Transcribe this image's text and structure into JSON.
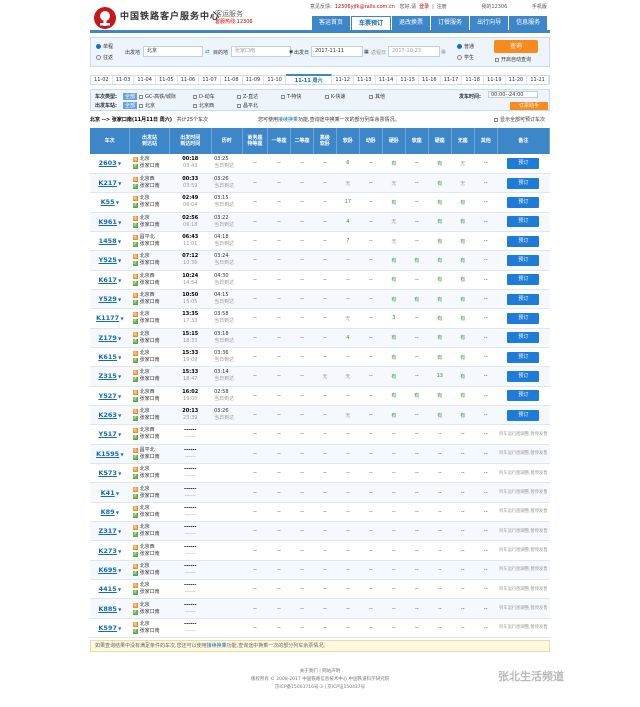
{
  "header": {
    "brand": "中国铁路客户服务中心",
    "sub": "客运服务",
    "hotline": "客服热线:12306",
    "links": [
      "意见反馈:",
      "12306yjfk@rails.com.cn",
      "您好,请",
      "登录",
      "|",
      "注册",
      "我的12306",
      "手机版"
    ],
    "nav": [
      "客运首页",
      "车票预订",
      "退改换票",
      "订餐服务",
      "出行向导",
      "信息服务"
    ]
  },
  "search": {
    "one_way": "单程",
    "round": "往返",
    "from_label": "出发地",
    "from": "北京",
    "to_label": "目的地",
    "to": "张家口南",
    "depart_label": "出发日",
    "depart": "2017-11-11",
    "return_label": "返程日",
    "return": "2017-10-23",
    "normal": "普通",
    "student": "学生",
    "query": "查询",
    "auto": "开启自动查询"
  },
  "dates": [
    "11-02",
    "11-03",
    "11-04",
    "11-05",
    "11-06",
    "11-07",
    "11-08",
    "11-09",
    "11-10",
    "11-11 周六",
    "11-12",
    "11-13",
    "11-14",
    "11-15",
    "11-16",
    "11-17",
    "11-18",
    "11-19",
    "11-20",
    "11-21"
  ],
  "filter": {
    "type_label": "车次类型:",
    "all": "全部",
    "types": [
      "GC-高铁/城际",
      "D-动车",
      "Z-直达",
      "T-特快",
      "K-快速",
      "其他"
    ],
    "station_label": "出发车站:",
    "stations": [
      "北京",
      "北京西",
      "昌平北"
    ],
    "time_label": "发车时间:",
    "time": "00:00--24:00",
    "order": "订票助手"
  },
  "summary": {
    "route": "北京 --> 张家口南(11月11日 周六)",
    "count": "共计25个车次",
    "note1": "您可使用",
    "note_link": "接续换乘",
    "note2": "功能,查询途中换乘一次的部分列车余票情况。",
    "check": "显示全部可预订车次"
  },
  "columns": [
    "车次",
    "出发站\n到达站",
    "出发时间\n到达时间",
    "历时",
    "商务座\n特等座",
    "一等座",
    "二等座",
    "高级\n软卧",
    "软卧",
    "动卧",
    "硬卧",
    "软座",
    "硬座",
    "无座",
    "其他",
    "备注"
  ],
  "book": "预订",
  "na": "列车运行图调整,暂停发售",
  "trains": [
    {
      "no": "2603",
      "s": [
        "北京",
        "张家口南"
      ],
      "ti": [
        "s",
        "e"
      ],
      "t": [
        "00:18",
        "03:43"
      ],
      "d": [
        "03:25",
        "当日到达"
      ],
      "c": [
        "--",
        "--",
        "--",
        "--",
        "6",
        "--",
        "有",
        "--",
        "有",
        "无",
        "--"
      ],
      "ok": true
    },
    {
      "no": "K217",
      "s": [
        "北京西",
        "张家口南"
      ],
      "ti": [
        "s",
        "e"
      ],
      "t": [
        "00:33",
        "03:59"
      ],
      "d": [
        "03:26",
        "当日到达"
      ],
      "c": [
        "--",
        "--",
        "--",
        "--",
        "无",
        "--",
        "无",
        "--",
        "有",
        "无",
        "--"
      ],
      "ok": true
    },
    {
      "no": "K55",
      "s": [
        "北京",
        "张家口南"
      ],
      "ti": [
        "s",
        "e"
      ],
      "t": [
        "02:49",
        "06:04"
      ],
      "d": [
        "03:15",
        "当日到达"
      ],
      "c": [
        "--",
        "--",
        "--",
        "--",
        "17",
        "--",
        "有",
        "--",
        "有",
        "有",
        "--"
      ],
      "ok": true
    },
    {
      "no": "K961",
      "s": [
        "北京",
        "张家口南"
      ],
      "ti": [
        "s",
        "e"
      ],
      "t": [
        "02:56",
        "06:18"
      ],
      "d": [
        "03:22",
        "当日到达"
      ],
      "c": [
        "--",
        "--",
        "--",
        "--",
        "4",
        "--",
        "无",
        "--",
        "有",
        "有",
        "--"
      ],
      "ok": true
    },
    {
      "no": "1458",
      "s": [
        "昌平北",
        "张家口南"
      ],
      "ti": [
        "s",
        "e"
      ],
      "t": [
        "06:43",
        "11:01"
      ],
      "d": [
        "04:18",
        "当日到达"
      ],
      "c": [
        "--",
        "--",
        "--",
        "--",
        "7",
        "--",
        "无",
        "--",
        "有",
        "有",
        "--"
      ],
      "ok": true
    },
    {
      "no": "Y525",
      "s": [
        "北京",
        "张家口南"
      ],
      "ti": [
        "s",
        "e"
      ],
      "t": [
        "07:12",
        "10:36"
      ],
      "d": [
        "03:24",
        "当日到达"
      ],
      "c": [
        "--",
        "--",
        "--",
        "--",
        "--",
        "--",
        "有",
        "有",
        "有",
        "有",
        "--"
      ],
      "ok": true
    },
    {
      "no": "K617",
      "s": [
        "北京西",
        "张家口南"
      ],
      "ti": [
        "s",
        "e"
      ],
      "t": [
        "10:24",
        "14:54"
      ],
      "d": [
        "04:30",
        "当日到达"
      ],
      "c": [
        "--",
        "--",
        "--",
        "--",
        "--",
        "--",
        "有",
        "--",
        "有",
        "有",
        "--"
      ],
      "ok": true
    },
    {
      "no": "Y529",
      "s": [
        "北京西",
        "张家口南"
      ],
      "ti": [
        "s",
        "e"
      ],
      "t": [
        "10:50",
        "15:05"
      ],
      "d": [
        "04:15",
        "当日到达"
      ],
      "c": [
        "--",
        "--",
        "--",
        "--",
        "--",
        "--",
        "有",
        "有",
        "有",
        "有",
        "--"
      ],
      "ok": true
    },
    {
      "no": "K1177",
      "s": [
        "北京",
        "张家口南"
      ],
      "ti": [
        "s",
        "e"
      ],
      "t": [
        "13:35",
        "17:33"
      ],
      "d": [
        "03:58",
        "当日到达"
      ],
      "c": [
        "--",
        "--",
        "--",
        "--",
        "无",
        "--",
        "3",
        "--",
        "有",
        "有",
        "--"
      ],
      "ok": true
    },
    {
      "no": "Z179",
      "s": [
        "北京",
        "张家口南"
      ],
      "ti": [
        "s",
        "e"
      ],
      "t": [
        "15:15",
        "18:33"
      ],
      "d": [
        "03:18",
        "当日到达"
      ],
      "c": [
        "--",
        "--",
        "--",
        "--",
        "4",
        "--",
        "有",
        "--",
        "有",
        "有",
        "--"
      ],
      "ok": true
    },
    {
      "no": "K615",
      "s": [
        "北京",
        "张家口南"
      ],
      "ti": [
        "s",
        "e"
      ],
      "t": [
        "15:33",
        "19:09"
      ],
      "d": [
        "03:36",
        "当日到达"
      ],
      "c": [
        "--",
        "--",
        "--",
        "--",
        "--",
        "--",
        "有",
        "--",
        "有",
        "有",
        "--"
      ],
      "ok": true
    },
    {
      "no": "Z315",
      "s": [
        "北京",
        "张家口南"
      ],
      "ti": [
        "s",
        "e"
      ],
      "t": [
        "15:33",
        "18:47"
      ],
      "d": [
        "03:14",
        "当日到达"
      ],
      "c": [
        "--",
        "--",
        "--",
        "无",
        "无",
        "--",
        "有",
        "--",
        "13",
        "有",
        "--"
      ],
      "ok": true
    },
    {
      "no": "Y527",
      "s": [
        "北京西",
        "张家口南"
      ],
      "ti": [
        "s",
        "e"
      ],
      "t": [
        "16:02",
        "19:00"
      ],
      "d": [
        "02:58",
        "当日到达"
      ],
      "c": [
        "--",
        "--",
        "--",
        "--",
        "--",
        "--",
        "有",
        "有",
        "有",
        "有",
        "--"
      ],
      "ok": true
    },
    {
      "no": "K263",
      "s": [
        "北京",
        "张家口南"
      ],
      "ti": [
        "s",
        "e"
      ],
      "t": [
        "20:13",
        "23:39"
      ],
      "d": [
        "03:26",
        "当日到达"
      ],
      "c": [
        "--",
        "--",
        "--",
        "--",
        "无",
        "--",
        "有",
        "--",
        "有",
        "有",
        "--"
      ],
      "ok": true
    },
    {
      "no": "Y517",
      "s": [
        "北京西",
        "张家口南"
      ],
      "ti": [
        "s",
        "e"
      ],
      "t": [
        "------",
        "------"
      ],
      "d": [
        "",
        ""
      ],
      "c": [
        "--",
        "--",
        "--",
        "--",
        "--",
        "--",
        "--",
        "--",
        "--",
        "--",
        "--"
      ],
      "ok": false
    },
    {
      "no": "K1595",
      "s": [
        "昌平北",
        "张家口南"
      ],
      "ti": [
        "s",
        "e"
      ],
      "t": [
        "------",
        "------"
      ],
      "d": [
        "",
        ""
      ],
      "c": [
        "--",
        "--",
        "--",
        "--",
        "--",
        "--",
        "--",
        "--",
        "--",
        "--",
        "--"
      ],
      "ok": false
    },
    {
      "no": "K573",
      "s": [
        "北京",
        "张家口南"
      ],
      "ti": [
        "s",
        "e"
      ],
      "t": [
        "------",
        "------"
      ],
      "d": [
        "",
        ""
      ],
      "c": [
        "--",
        "--",
        "--",
        "--",
        "--",
        "--",
        "--",
        "--",
        "--",
        "--",
        "--"
      ],
      "ok": false
    },
    {
      "no": "K41",
      "s": [
        "北京",
        "张家口南"
      ],
      "ti": [
        "s",
        "e"
      ],
      "t": [
        "------",
        "------"
      ],
      "d": [
        "",
        ""
      ],
      "c": [
        "--",
        "--",
        "--",
        "--",
        "--",
        "--",
        "--",
        "--",
        "--",
        "--",
        "--"
      ],
      "ok": false
    },
    {
      "no": "K89",
      "s": [
        "北京",
        "张家口南"
      ],
      "ti": [
        "s",
        "e"
      ],
      "t": [
        "------",
        "------"
      ],
      "d": [
        "",
        ""
      ],
      "c": [
        "--",
        "--",
        "--",
        "--",
        "--",
        "--",
        "--",
        "--",
        "--",
        "--",
        "--"
      ],
      "ok": false
    },
    {
      "no": "Z317",
      "s": [
        "北京",
        "张家口南"
      ],
      "ti": [
        "s",
        "e"
      ],
      "t": [
        "------",
        "------"
      ],
      "d": [
        "",
        ""
      ],
      "c": [
        "--",
        "--",
        "--",
        "--",
        "--",
        "--",
        "--",
        "--",
        "--",
        "--",
        "--"
      ],
      "ok": false
    },
    {
      "no": "K273",
      "s": [
        "北京西",
        "张家口南"
      ],
      "ti": [
        "s",
        "e"
      ],
      "t": [
        "------",
        "------"
      ],
      "d": [
        "",
        ""
      ],
      "c": [
        "--",
        "--",
        "--",
        "--",
        "--",
        "--",
        "--",
        "--",
        "--",
        "--",
        "--"
      ],
      "ok": false
    },
    {
      "no": "K695",
      "s": [
        "北京",
        "张家口南"
      ],
      "ti": [
        "s",
        "e"
      ],
      "t": [
        "------",
        "------"
      ],
      "d": [
        "",
        ""
      ],
      "c": [
        "--",
        "--",
        "--",
        "--",
        "--",
        "--",
        "--",
        "--",
        "--",
        "--",
        "--"
      ],
      "ok": false
    },
    {
      "no": "4415",
      "s": [
        "北京",
        "张家口南"
      ],
      "ti": [
        "s",
        "e"
      ],
      "t": [
        "------",
        "------"
      ],
      "d": [
        "",
        ""
      ],
      "c": [
        "--",
        "--",
        "--",
        "--",
        "--",
        "--",
        "--",
        "--",
        "--",
        "--",
        "--"
      ],
      "ok": false
    },
    {
      "no": "K885",
      "s": [
        "北京",
        "张家口南"
      ],
      "ti": [
        "s",
        "e"
      ],
      "t": [
        "------",
        "------"
      ],
      "d": [
        "",
        ""
      ],
      "c": [
        "--",
        "--",
        "--",
        "--",
        "--",
        "--",
        "--",
        "--",
        "--",
        "--",
        "--"
      ],
      "ok": false
    },
    {
      "no": "K597",
      "s": [
        "北京",
        "张家口南"
      ],
      "ti": [
        "s",
        "e"
      ],
      "t": [
        "------",
        "------"
      ],
      "d": [
        "",
        ""
      ],
      "c": [
        "--",
        "--",
        "--",
        "--",
        "--",
        "--",
        "--",
        "--",
        "--",
        "--",
        "--"
      ],
      "ok": false
    }
  ],
  "footnote": {
    "a": "如果查询结果中没有满足条件的车次,您还可以使用",
    "link": "接续换乘",
    "b": "功能,查询途中换乘一次的部分列车余票情况。"
  },
  "footer": [
    "关于我们 | 网站声明",
    "版权所有 © 2008-2017 中国铁路信息技术中心 中国铁道科学研究院",
    "京ICP备15003716号-3 | 京ICP证150437号"
  ],
  "watermark": "张北生活频道"
}
